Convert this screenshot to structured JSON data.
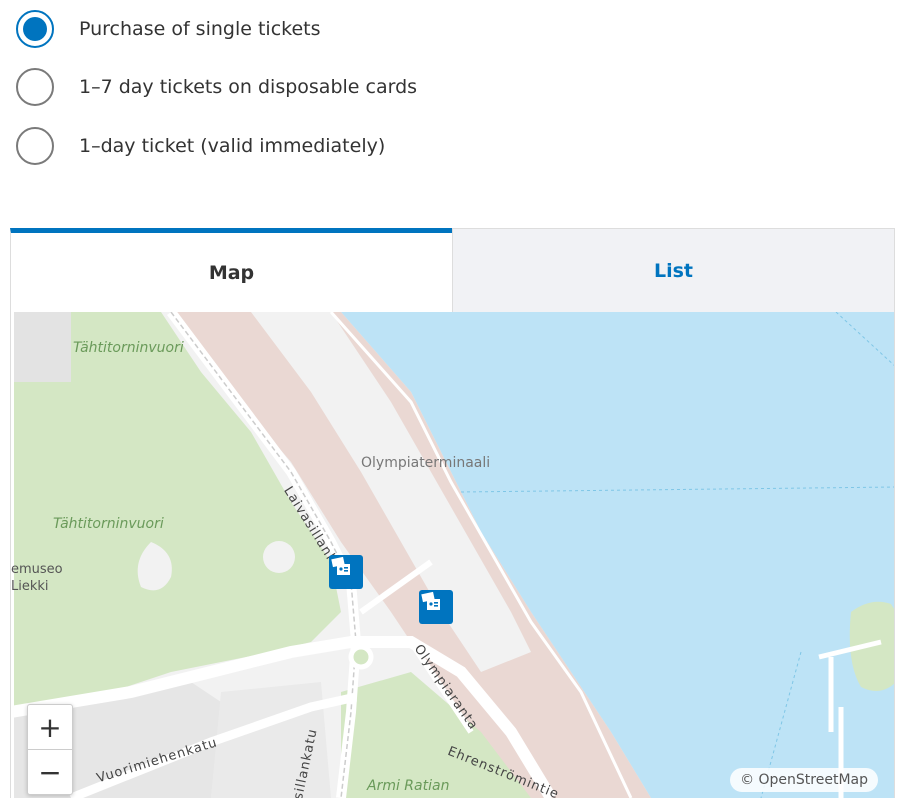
{
  "ticket_options": [
    {
      "label": "Purchase of single tickets",
      "selected": true
    },
    {
      "label": "1–7 day tickets on disposable cards",
      "selected": false
    },
    {
      "label": "1–day ticket (valid immediately)",
      "selected": false
    }
  ],
  "tabs": {
    "map": "Map",
    "list": "List",
    "active": "Map"
  },
  "map": {
    "labels": {
      "tahtitorninvuori_1": "Tähtitorninvuori",
      "tahtitorninvuori_2": "Tähtitorninvuori",
      "olympiaterminaali": "Olympiaterminaali",
      "laivasillankatu": "Laivasillank.",
      "museo_1": "emuseo",
      "museo_2": "Liekki",
      "olympiaranta": "Olympiaranta",
      "vuorimiehenkatu": "Vuorimiehenkatu",
      "ehrenstromintie": "Ehrenströmintie",
      "sillankatu": "sillankatu",
      "armi_ratian": "Armi Ratian"
    },
    "markers": [
      "ticket-machine-icon",
      "ticket-machine-icon"
    ],
    "zoom_in": "+",
    "zoom_out": "−",
    "attribution": "© OpenStreetMap",
    "colors": {
      "water": "#bde3f6",
      "park": "#d4e7c4",
      "land": "#f2f2f2",
      "port": "#ead8d3",
      "accent": "#0074bf"
    }
  }
}
